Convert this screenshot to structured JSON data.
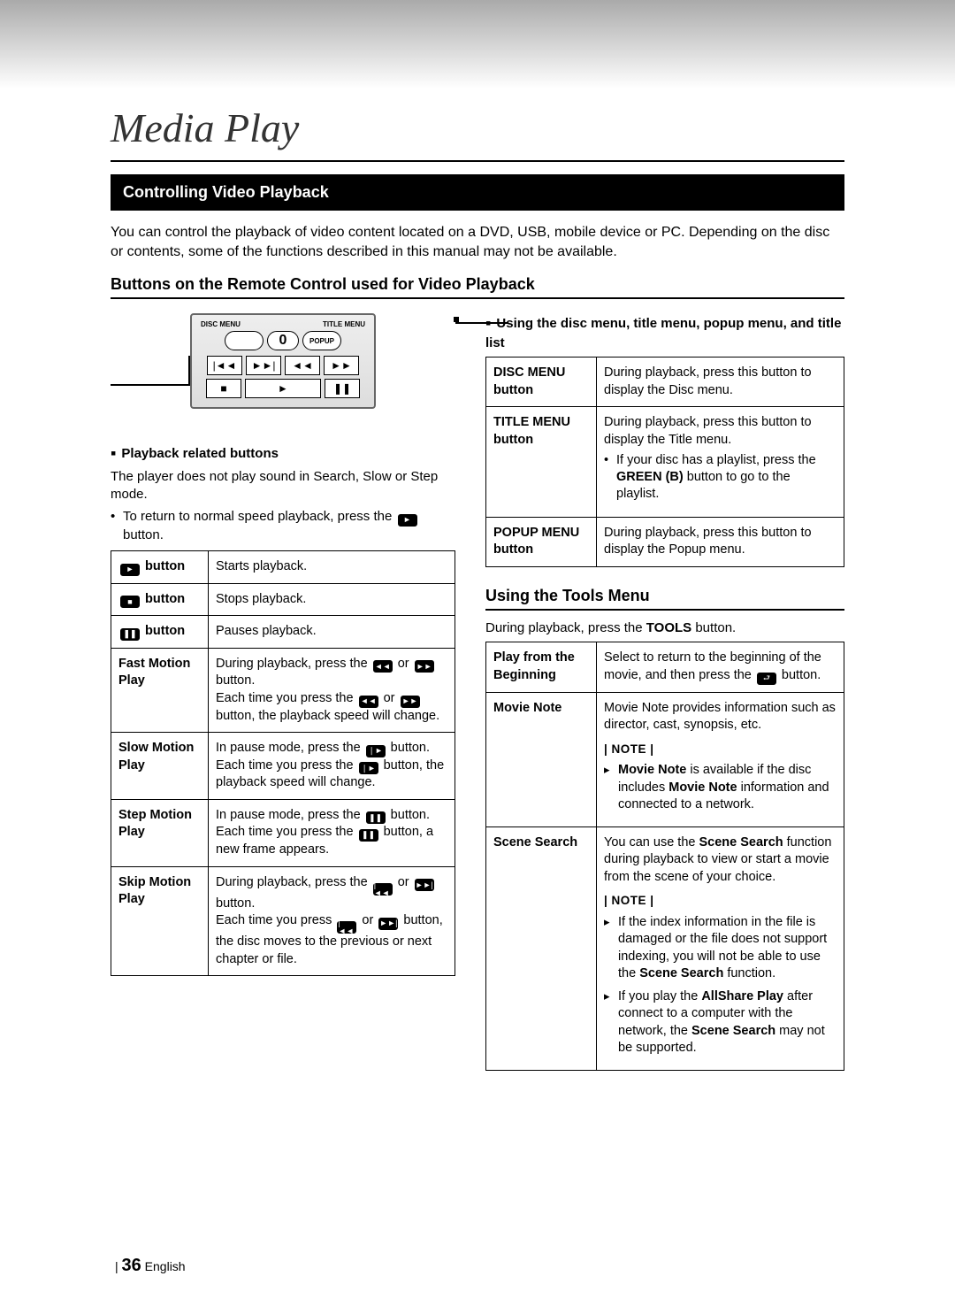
{
  "page_title": "Media Play",
  "section_bar": "Controlling Video Playback",
  "intro": "You can control the playback of video content located on a DVD, USB, mobile device or PC. Depending on the disc or contents, some of the functions described in this manual may not be available.",
  "subheading": "Buttons on the Remote Control used for Video Playback",
  "remote": {
    "disc_menu": "DISC MENU",
    "title_menu": "TITLE MENU",
    "popup": "POPUP",
    "zero": "0"
  },
  "left": {
    "mini1": "Playback related buttons",
    "para1": "The player does not play sound in Search, Slow or Step mode.",
    "return_bullet_a": "To return to normal speed playback, press the ",
    "return_bullet_b": " button.",
    "table": [
      {
        "label_icon": "play",
        "label_suffix": " button",
        "desc": "Starts playback."
      },
      {
        "label_icon": "stop",
        "label_suffix": " button",
        "desc": "Stops playback."
      },
      {
        "label_icon": "pause",
        "label_suffix": " button",
        "desc": "Pauses playback."
      }
    ],
    "fast_label": "Fast Motion Play",
    "fast_a": "During playback, press the ",
    "fast_or": " or ",
    "fast_b": " button.",
    "fast_c": "Each time you press the ",
    "fast_d": " button, the playback speed will change.",
    "slow_label": "Slow Motion Play",
    "slow_a": "In pause mode, press the ",
    "slow_b": " button.",
    "slow_c": "Each time you press the ",
    "slow_d": " button, the playback speed will change.",
    "step_label": "Step Motion Play",
    "step_a": "In pause mode, press the ",
    "step_b": " button.",
    "step_c": "Each time you press the ",
    "step_d": " button, a new frame appears.",
    "skip_label": "Skip Motion Play",
    "skip_a": "During playback, press the ",
    "skip_or": " or ",
    "skip_b": " button.",
    "skip_c": "Each time you press ",
    "skip_d": " button, the disc moves to the previous or next chapter or file."
  },
  "right": {
    "mini2": "Using the disc menu, title menu, popup menu, and title list",
    "menu_table": {
      "r1_label": "DISC MENU button",
      "r1_desc": "During playback, press this button to display the Disc menu.",
      "r2_label": "TITLE MENU button",
      "r2_desc_a": "During playback, press this button to display the Title menu.",
      "r2_bullet_a": "If your disc has a playlist, press the ",
      "r2_bullet_b": "GREEN (B)",
      "r2_bullet_c": " button to go to the playlist.",
      "r3_label": "POPUP MENU button",
      "r3_desc": "During playback, press this button to display the Popup menu."
    },
    "tools_heading": "Using the Tools Menu",
    "tools_intro_a": "During playback, press the ",
    "tools_intro_b": "TOOLS",
    "tools_intro_c": " button.",
    "tools_table": {
      "play_label": "Play from the Beginning",
      "play_desc_a": "Select to return to the beginning of the movie, and then press the ",
      "play_desc_b": " button.",
      "movie_label": "Movie Note",
      "movie_desc": "Movie Note provides information such as director, cast, synopsis, etc.",
      "note_label": "| NOTE |",
      "movie_note_a": "Movie Note",
      "movie_note_b": " is available if the disc includes ",
      "movie_note_c": "Movie Note",
      "movie_note_d": " information and connected to a network.",
      "scene_label": "Scene Search",
      "scene_desc_a": "You can use the ",
      "scene_desc_b": "Scene Search",
      "scene_desc_c": " function during playback to view or start a movie from the scene of your choice.",
      "scene_note1_a": "If the index information in the file is damaged or the file does not support indexing, you will not be able to use the ",
      "scene_note1_b": "Scene Search",
      "scene_note1_c": " function.",
      "scene_note2_a": "If you play the ",
      "scene_note2_b": "AllShare Play",
      "scene_note2_c": " after connect to a computer with the network, the ",
      "scene_note2_d": "Scene Search",
      "scene_note2_e": " may not be supported."
    }
  },
  "footer": {
    "page_num": "36",
    "lang": "English"
  }
}
